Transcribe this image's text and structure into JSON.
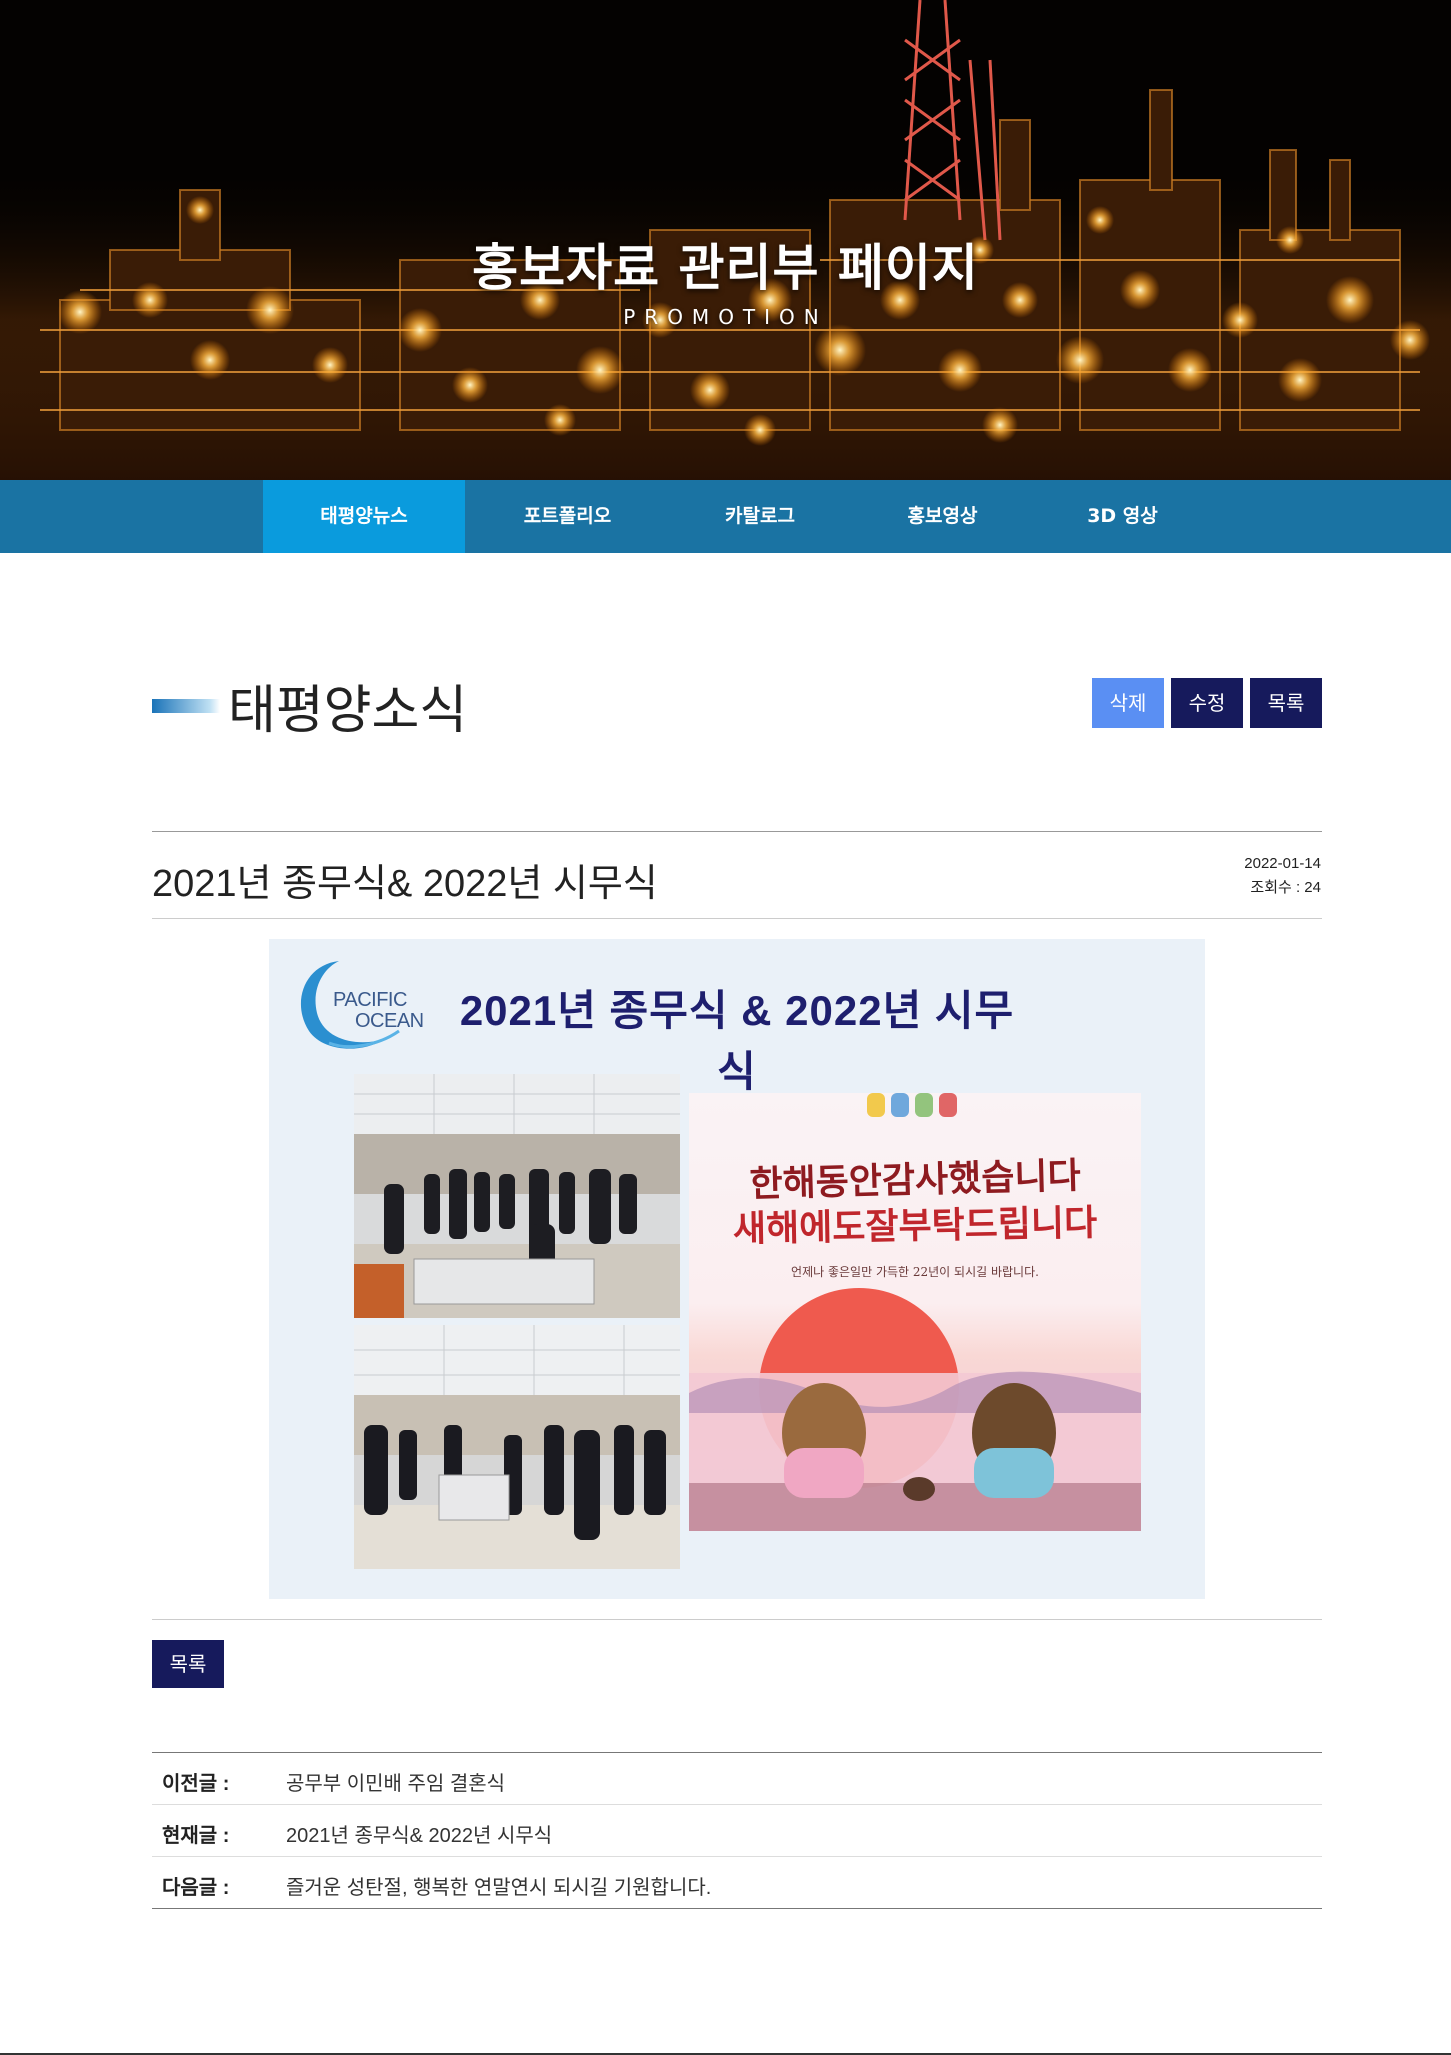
{
  "hero": {
    "title": "홍보자료 관리부 페이지",
    "subtitle": "PROMOTION"
  },
  "nav": {
    "items": [
      {
        "label": "태평양뉴스",
        "active": true
      },
      {
        "label": "포트폴리오",
        "active": false
      },
      {
        "label": "카탈로그",
        "active": false
      },
      {
        "label": "홍보영상",
        "active": false
      },
      {
        "label": "3D 영상",
        "active": false
      }
    ]
  },
  "section": {
    "title": "태평양소식",
    "buttons": {
      "delete": "삭제",
      "edit": "수정",
      "list": "목록"
    }
  },
  "post": {
    "title": "2021년 종무식& 2022년 시무식",
    "date": "2022-01-14",
    "views": "조회수 : 24",
    "poster": {
      "logo_line1": "PACIFIC",
      "logo_line2": "OCEAN",
      "heading": "2021년 종무식 & 2022년 시무식",
      "card_line1": "한해동안감사했습니다",
      "card_line2": "새해에도잘부탁드립니다",
      "card_line3": "언제나 좋은일만 가득한 22년이 되시길 바랍니다."
    }
  },
  "list_button": "목록",
  "navigation_table": [
    {
      "label": "이전글 :",
      "value": "공무부 이민배 주임 결혼식"
    },
    {
      "label": "현재글 :",
      "value": "2021년 종무식& 2022년 시무식"
    },
    {
      "label": "다음글 :",
      "value": "즐거운 성탄절, 행복한 연말연시 되시길 기원합니다."
    }
  ],
  "colors": {
    "nav_bg": "#1a73a3",
    "nav_active": "#0a9bdd",
    "button_dark": "#161a5c",
    "button_light": "#5a8ff3"
  }
}
